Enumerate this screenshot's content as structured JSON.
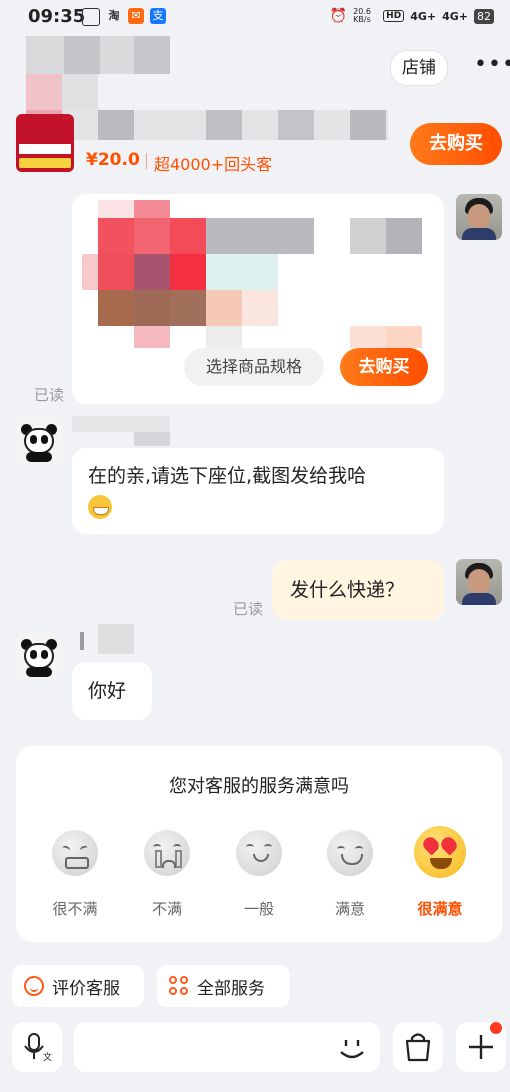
{
  "status_bar": {
    "time": "09:35",
    "net_speed": "20.6 KB/s",
    "signal1": "4G+",
    "signal2": "4G+",
    "battery": "82"
  },
  "header": {
    "shop_label": "店铺",
    "more_icon": "more-icon"
  },
  "product_bar": {
    "price": "¥20.0",
    "repeat_buyers": "超4000+回头客",
    "buy_label": "去购买"
  },
  "product_card": {
    "spec_label": "选择商品规格",
    "buy_label": "去购买"
  },
  "messages": [
    {
      "side": "right",
      "read": "已读"
    },
    {
      "side": "left",
      "text": "在的亲,请选下座位,截图发给我哈",
      "emoji": "grin-emoji"
    },
    {
      "side": "right",
      "text": "发什么快递？",
      "read": "已读"
    },
    {
      "side": "left",
      "text": "你好"
    }
  ],
  "rating": {
    "title": "您对客服的服务满意吗",
    "options": [
      {
        "label": "很不满",
        "icon": "angry-face-icon"
      },
      {
        "label": "不满",
        "icon": "crying-face-icon"
      },
      {
        "label": "一般",
        "icon": "neutral-face-icon"
      },
      {
        "label": "满意",
        "icon": "smile-face-icon"
      },
      {
        "label": "很满意",
        "icon": "heart-eyes-face-icon"
      }
    ],
    "highlight_color": "#ff5000"
  },
  "tools": {
    "evaluate": "评价客服",
    "all_services": "全部服务"
  },
  "input_bar": {
    "voice_icon": "voice-icon",
    "emoji_icon": "emoji-icon",
    "bag_icon": "shopping-bag-icon",
    "plus_icon": "plus-icon"
  },
  "colors": {
    "accent": "#ff5000",
    "background": "#f1f2f6",
    "outgoing_bubble": "#fff5e0"
  }
}
